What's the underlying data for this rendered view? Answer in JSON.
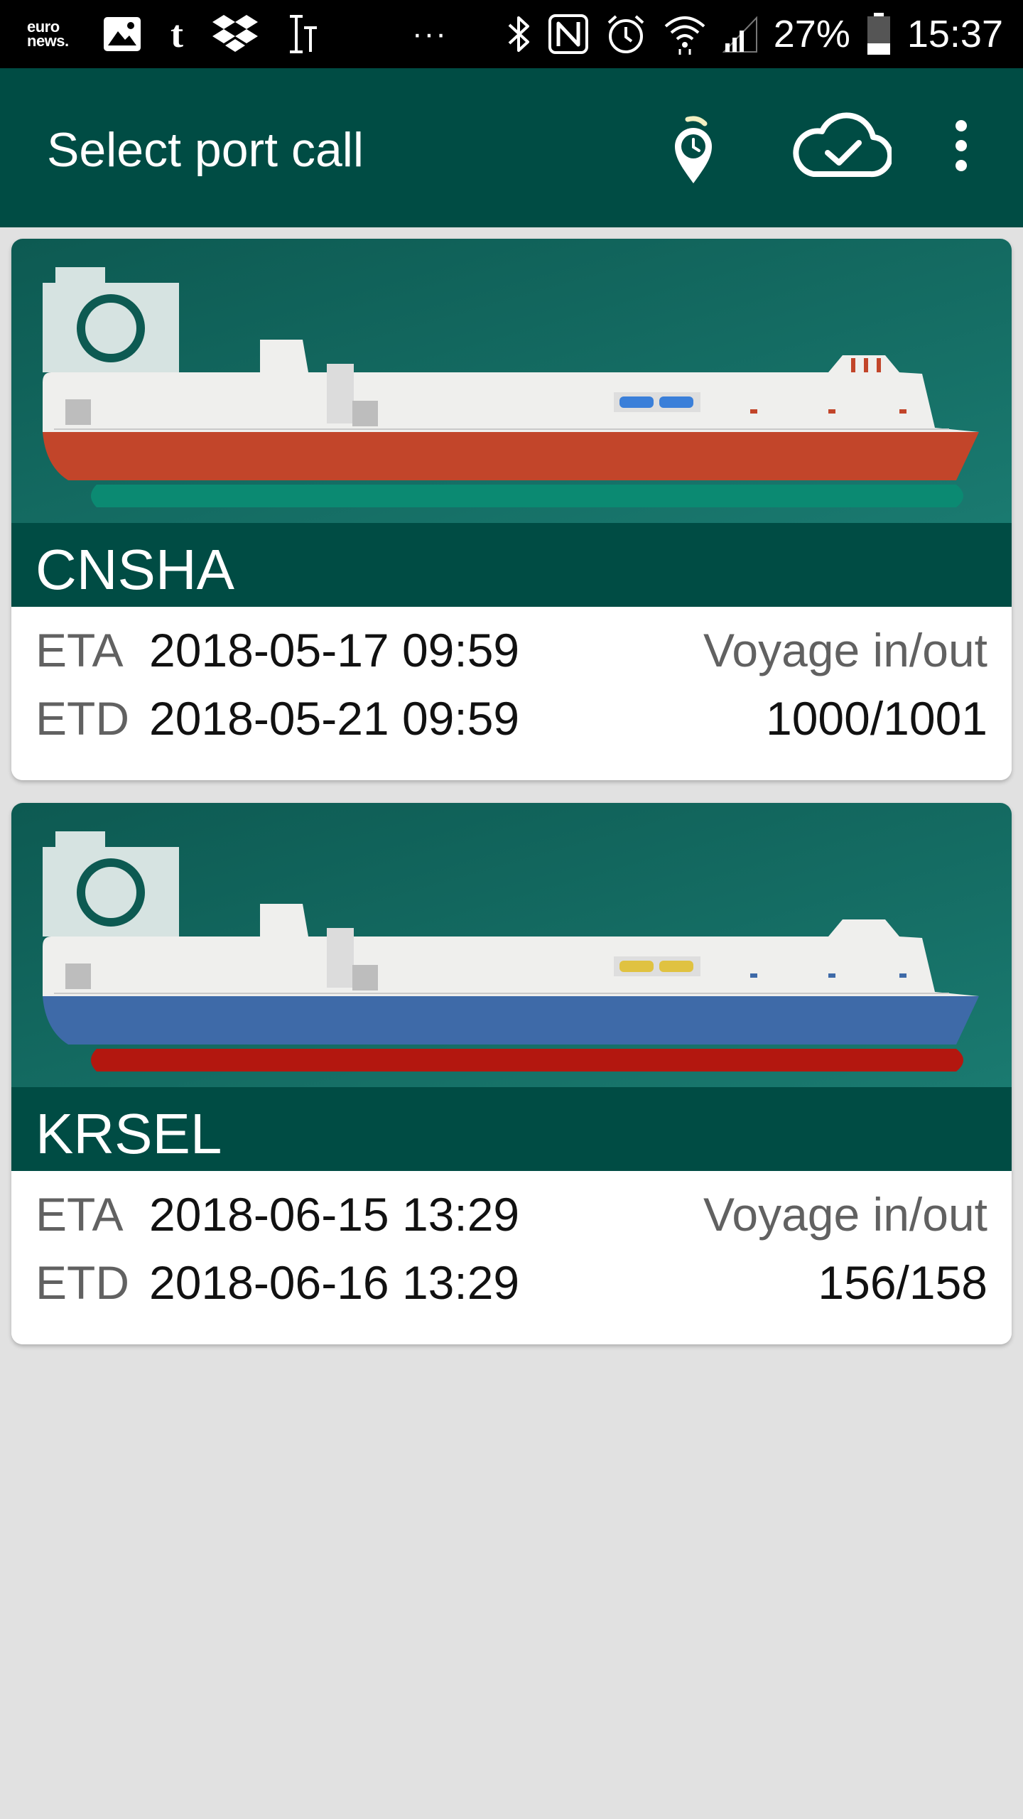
{
  "status_bar": {
    "left_icons": [
      "euronews-icon",
      "gallery-icon",
      "tumblr-icon",
      "dropbox-icon",
      "text-cursor-icon",
      "more-notifications-icon"
    ],
    "euronews_text": "euro news.",
    "tumblr_glyph": "t",
    "more_dots": "···",
    "right_icons": [
      "bluetooth-icon",
      "nfc-icon",
      "alarm-icon",
      "wifi-icon",
      "cell-signal-icon",
      "battery-icon"
    ],
    "battery_percent": "27%",
    "time": "15:37"
  },
  "app_bar": {
    "title": "Select port call",
    "actions": [
      "location-clock-icon",
      "cloud-check-icon",
      "overflow-menu-icon"
    ],
    "background_color": "#004c44"
  },
  "port_calls": [
    {
      "port_code": "CNSHA",
      "eta_label": "ETA",
      "eta_value": "2018-05-17 09:59",
      "etd_label": "ETD",
      "etd_value": "2018-05-21 09:59",
      "voyage_label": "Voyage in/out",
      "voyage_value": "1000/1001",
      "hull_color": "#c2452a",
      "bottom_color": "#0b8a72",
      "lifeboat_color": "#3a7fd9"
    },
    {
      "port_code": "KRSEL",
      "eta_label": "ETA",
      "eta_value": "2018-06-15 13:29",
      "etd_label": "ETD",
      "etd_value": "2018-06-16 13:29",
      "voyage_label": "Voyage in/out",
      "voyage_value": "156/158",
      "hull_color": "#3e6aa8",
      "bottom_color": "#b3170f",
      "lifeboat_color": "#e0c241"
    }
  ]
}
